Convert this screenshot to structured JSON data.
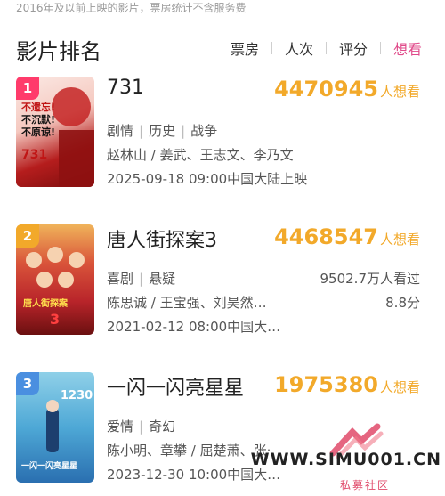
{
  "top_note": "2016年及以前上映的影片，票房统计不含服务费",
  "section_title": "影片排名",
  "sort_tabs": [
    "票房",
    "人次",
    "评分",
    "想看"
  ],
  "active_tab": "想看",
  "want_label": "人想看",
  "movies": [
    {
      "rank": "1",
      "title": "731",
      "want_count": "4470945",
      "genres": [
        "剧情",
        "历史",
        "战争"
      ],
      "cast": "赵林山 / 姜武、王志文、李乃文",
      "release": "2025-09-18 09:00中国大陆上映",
      "views": "",
      "score": "",
      "badge_color": "#ff3b6b",
      "poster_text": [
        "不遗忘!",
        "不沉默!",
        "不原谅!"
      ],
      "poster_title": "731"
    },
    {
      "rank": "2",
      "title": "唐人街探案3",
      "want_count": "4468547",
      "genres": [
        "喜剧",
        "悬疑"
      ],
      "cast": "陈思诚 / 王宝强、刘昊然…",
      "release": "2021-02-12 08:00中国大…",
      "views": "9502.7万人看过",
      "score": "8.8分",
      "badge_color": "#f2a92a",
      "poster_text": [
        "唐人街探案"
      ],
      "poster_title": "3"
    },
    {
      "rank": "3",
      "title": "一闪一闪亮星星",
      "want_count": "1975380",
      "genres": [
        "爱情",
        "奇幻"
      ],
      "cast": "陈小明、章攀 / 屈楚萧、张·",
      "release": "2023-12-30 10:00中国大…",
      "views": "",
      "score": "",
      "badge_color": "#4a8fe0",
      "poster_text": [
        "1230",
        "一闪一闪亮星星"
      ],
      "poster_title": ""
    }
  ],
  "watermark": {
    "site": "WWW.SIMU001.CN",
    "sub": "私募社区"
  }
}
